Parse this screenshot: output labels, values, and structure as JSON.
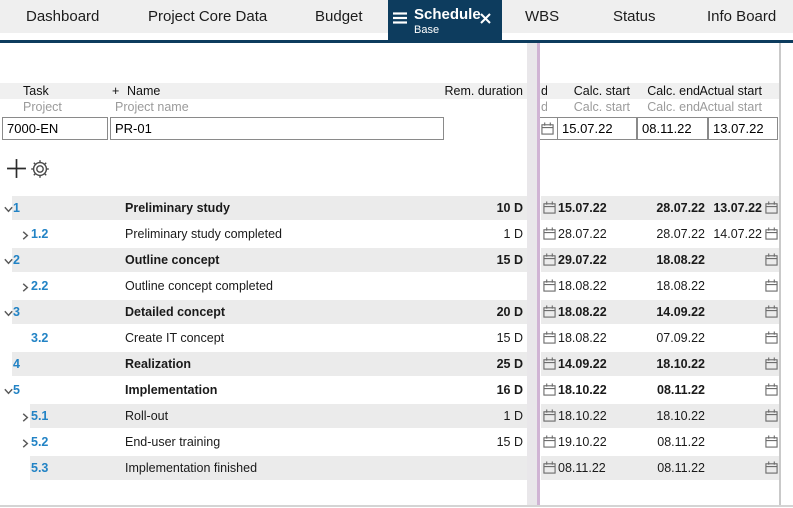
{
  "tabs": {
    "items": [
      "Dashboard",
      "Project Core Data",
      "Budget",
      "WBS",
      "Status",
      "Info Board"
    ],
    "active": {
      "label": "Schedule",
      "sublabel": "Base"
    }
  },
  "icons": {
    "menu": "menu-icon",
    "close": "close-icon",
    "add": "plus-icon",
    "settings": "gear-icon",
    "date": "calendar-icon",
    "expanded": "chevron-down-icon",
    "collapsed": "chevron-right-icon"
  },
  "colors": {
    "accent_navy": "#0d3c5e",
    "task_id_blue": "#2283c5",
    "row_stripe": "#ebebeb",
    "splitter_purple": "#d0b4d4"
  },
  "table": {
    "headers": {
      "task": "Task",
      "name_plus": "+",
      "name": "Name",
      "rem_duration": "Rem. duration",
      "clipped_fragment": "d",
      "calc_start": "Calc. start",
      "calc_end": "Calc. end",
      "actual_start": "Actual start"
    },
    "subheaders": {
      "project": "Project",
      "project_name": "Project name",
      "clipped_fragment": "d",
      "calc_start": "Calc. start",
      "calc_end": "Calc. end",
      "actual_start": "Actual start"
    },
    "project_row": {
      "id": "7000-EN",
      "name": "PR-01",
      "calc_start": "15.07.22",
      "calc_end": "08.11.22",
      "actual_start": "13.07.22"
    },
    "rows": [
      {
        "id": "1",
        "level": 1,
        "expand": "expanded",
        "name": "Preliminary study",
        "summary": true,
        "rem_duration": "10 D",
        "calc_start": "15.07.22",
        "calc_end": "28.07.22",
        "actual_start": "13.07.22",
        "striped": true
      },
      {
        "id": "1.2",
        "level": 2,
        "expand": "collapsed",
        "name": "Preliminary study completed",
        "summary": false,
        "rem_duration": "1 D",
        "calc_start": "28.07.22",
        "calc_end": "28.07.22",
        "actual_start": "14.07.22",
        "striped": false
      },
      {
        "id": "2",
        "level": 1,
        "expand": "expanded",
        "name": "Outline concept",
        "summary": true,
        "rem_duration": "15 D",
        "calc_start": "29.07.22",
        "calc_end": "18.08.22",
        "actual_start": "",
        "striped": true
      },
      {
        "id": "2.2",
        "level": 2,
        "expand": "collapsed",
        "name": "Outline concept completed",
        "summary": false,
        "rem_duration": "",
        "calc_start": "18.08.22",
        "calc_end": "18.08.22",
        "actual_start": "",
        "striped": false
      },
      {
        "id": "3",
        "level": 1,
        "expand": "expanded",
        "name": "Detailed concept",
        "summary": true,
        "rem_duration": "20 D",
        "calc_start": "18.08.22",
        "calc_end": "14.09.22",
        "actual_start": "",
        "striped": true
      },
      {
        "id": "3.2",
        "level": 2,
        "expand": "none",
        "name": "Create IT concept",
        "summary": false,
        "rem_duration": "15 D",
        "calc_start": "18.08.22",
        "calc_end": "07.09.22",
        "actual_start": "",
        "striped": false
      },
      {
        "id": "4",
        "level": 1,
        "expand": "none",
        "name": "Realization",
        "summary": true,
        "rem_duration": "25 D",
        "calc_start": "14.09.22",
        "calc_end": "18.10.22",
        "actual_start": "",
        "striped": true
      },
      {
        "id": "5",
        "level": 1,
        "expand": "expanded",
        "name": "Implementation",
        "summary": true,
        "rem_duration": "16 D",
        "calc_start": "18.10.22",
        "calc_end": "08.11.22",
        "actual_start": "",
        "striped": false
      },
      {
        "id": "5.1",
        "level": 2,
        "expand": "collapsed",
        "name": "Roll-out",
        "summary": false,
        "rem_duration": "1 D",
        "calc_start": "18.10.22",
        "calc_end": "18.10.22",
        "actual_start": "",
        "striped": true
      },
      {
        "id": "5.2",
        "level": 2,
        "expand": "collapsed",
        "name": "End-user training",
        "summary": false,
        "rem_duration": "15 D",
        "calc_start": "19.10.22",
        "calc_end": "08.11.22",
        "actual_start": "",
        "striped": false
      },
      {
        "id": "5.3",
        "level": 2,
        "expand": "none",
        "name": "Implementation finished",
        "summary": false,
        "rem_duration": "",
        "calc_start": "08.11.22",
        "calc_end": "08.11.22",
        "actual_start": "",
        "striped": true
      }
    ]
  }
}
